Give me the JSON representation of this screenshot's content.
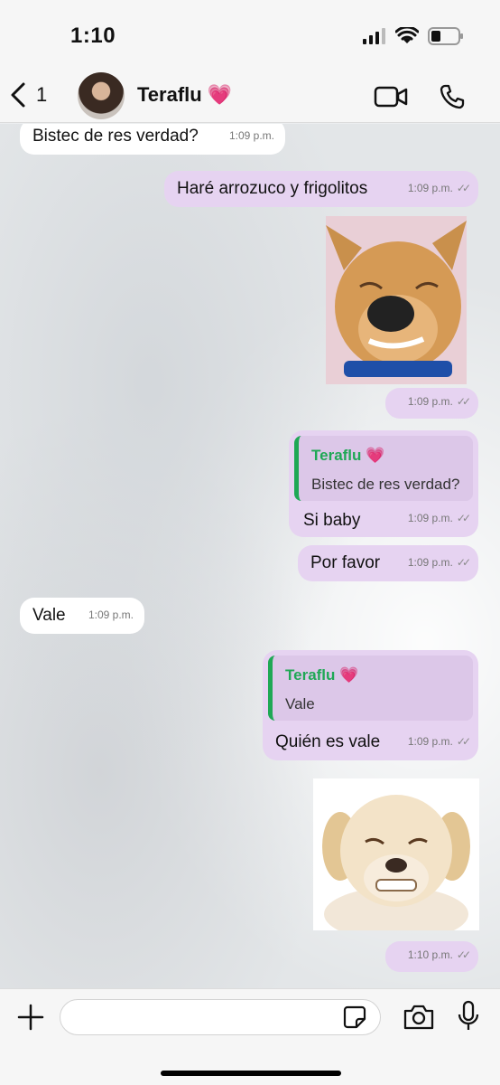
{
  "status_bar": {
    "time": "1:10"
  },
  "header": {
    "back_count": "1",
    "contact_name": "Teraflu",
    "contact_emoji": "💗"
  },
  "messages": [
    {
      "direction": "in",
      "text": "Bistec de res verdad?",
      "time": "1:09 p.m."
    },
    {
      "direction": "out",
      "text": "Haré arrozuco y frigolitos",
      "time": "1:09 p.m."
    },
    {
      "direction": "out",
      "type": "image",
      "image_desc": "sticker-chihuahua",
      "time": "1:09 p.m."
    },
    {
      "direction": "out",
      "quote_name": "Teraflu 💗",
      "quote_text": "Bistec de res verdad?",
      "text": "Si baby",
      "time": "1:09 p.m."
    },
    {
      "direction": "out",
      "text": "Por favor",
      "time": "1:09 p.m."
    },
    {
      "direction": "in",
      "text": "Vale",
      "time": "1:09 p.m."
    },
    {
      "direction": "out",
      "quote_name": "Teraflu 💗",
      "quote_text": "Vale",
      "text": "Quién es vale",
      "time": "1:09 p.m."
    },
    {
      "direction": "out",
      "type": "image",
      "image_desc": "sticker-puppy",
      "time": "1:10 p.m."
    }
  ],
  "input": {
    "placeholder": ""
  },
  "icons": {
    "back": "chevron-left-icon",
    "video": "video-camera-icon",
    "call": "phone-icon",
    "plus": "plus-icon",
    "sticker": "sticker-icon",
    "camera": "camera-icon",
    "mic": "microphone-icon"
  },
  "colors": {
    "outgoing_bubble": "#e6d3f1",
    "incoming_bubble": "#ffffff",
    "quote_accent": "#1fa855"
  }
}
